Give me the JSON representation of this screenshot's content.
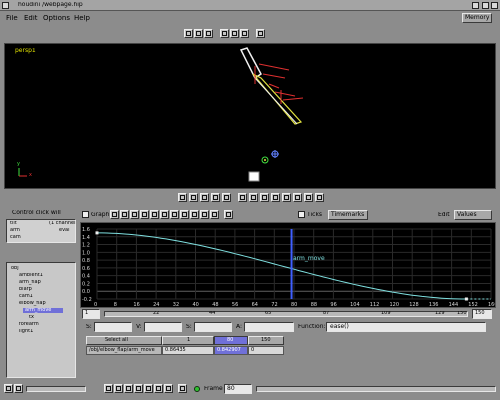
{
  "window": {
    "title": "houdini /webpage.hip",
    "menus": [
      "File",
      "Edit",
      "Options",
      "Help"
    ],
    "memory_label": "Memory"
  },
  "viewport": {
    "camera_label": "persp1",
    "axis_y": "y",
    "axis_x": "x"
  },
  "channel_panel": {
    "header_label": "Control click will",
    "channel_list": [
      "tilt",
      "arm",
      "cam"
    ],
    "channel_right": [
      "(1 channel",
      "eval"
    ],
    "tree_items": [
      "obj",
      "ambient1",
      "arm_flap",
      "blarp",
      "cam1",
      "elbow_flap",
      "arm_move",
      "tx",
      "forearm",
      "light1"
    ]
  },
  "graph_toolbar": {
    "graph_label": "Graph",
    "ticks_label": "Ticks",
    "timemarks_label": "Timemarks",
    "edit_label": "Edit",
    "values_label": "Values"
  },
  "graph": {
    "curve_label": "arm_move",
    "y_ticks": [
      "1.6",
      "1.4",
      "1.2",
      "1.0",
      "0.8",
      "0.6",
      "0.4",
      "0.2",
      "0.0",
      "-0.2"
    ],
    "x_ticks": [
      "0",
      "8",
      "16",
      "24",
      "32",
      "40",
      "48",
      "56",
      "64",
      "72",
      "80",
      "88",
      "96",
      "104",
      "112",
      "120",
      "128",
      "136",
      "144",
      "152",
      "160"
    ],
    "frame_marker": 79,
    "curve_color": "#7fe0e0"
  },
  "timeline": {
    "start_frame": "1",
    "markers": [
      "22",
      "44",
      "65",
      "87",
      "109",
      "129",
      "150"
    ],
    "end_frame": "150"
  },
  "expression_row": {
    "fields": [
      "S:",
      "V:",
      "S:",
      "A:"
    ],
    "function_label": "Function:",
    "function_value": "ease()"
  },
  "spreadsheet": {
    "select_all": "Select all",
    "columns": [
      "1",
      "80",
      "150"
    ],
    "row_label": "/obj/elbow_flap/arm_move",
    "row_values": [
      "0.86435",
      "0.842907",
      "0"
    ]
  },
  "playbar": {
    "frame_label": "Frame",
    "frame_value": "80"
  },
  "colors": {
    "viewport_bg": "#000000",
    "graph_bg": "#000000",
    "panel_gray": "#8c8c8c",
    "highlight_blue": "#7070d8"
  }
}
